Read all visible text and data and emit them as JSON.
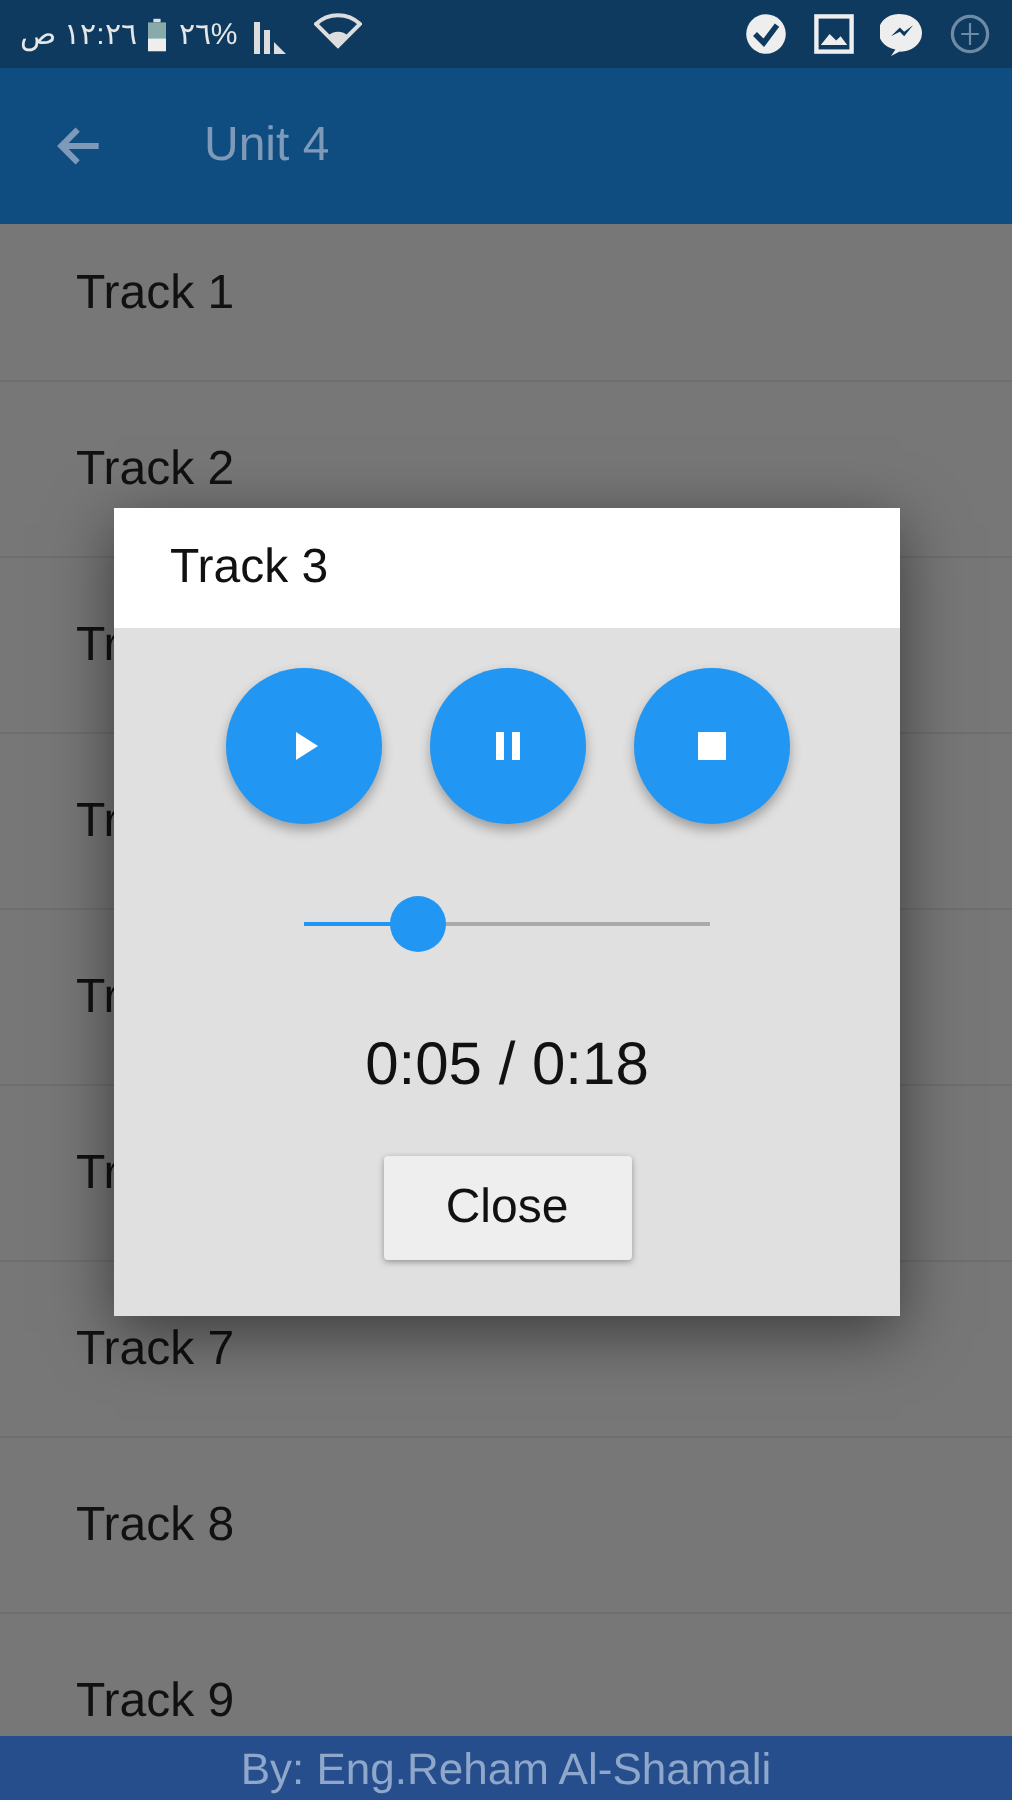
{
  "status_bar": {
    "time": "١٢:٢٦ ص",
    "battery": "%٢٦"
  },
  "app_bar": {
    "title": "Unit 4"
  },
  "tracks": [
    {
      "label": "Track 1"
    },
    {
      "label": "Track 2"
    },
    {
      "label": "Tr"
    },
    {
      "label": "Tr"
    },
    {
      "label": "Tr"
    },
    {
      "label": "Tr"
    },
    {
      "label": "Track 7"
    },
    {
      "label": "Track 8"
    },
    {
      "label": "Track 9"
    }
  ],
  "dialog": {
    "title": "Track 3",
    "controls": [
      {
        "kind": "play"
      },
      {
        "kind": "pause"
      },
      {
        "kind": "stop"
      }
    ],
    "seek": {
      "level": 0.28
    },
    "time": "0:05 / 0:18",
    "close": "Close"
  },
  "footer": "By: Eng.Reham Al-Shamali"
}
